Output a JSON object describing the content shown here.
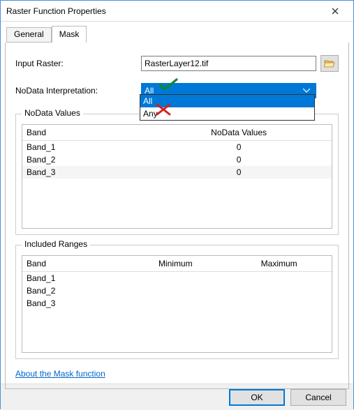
{
  "window": {
    "title": "Raster Function Properties"
  },
  "tabs": {
    "general": "General",
    "mask": "Mask"
  },
  "form": {
    "input_raster_label": "Input Raster:",
    "input_raster_value": "RasterLayer12.tif",
    "nodata_interp_label": "NoData Interpretation:",
    "nodata_interp_value": "All",
    "nodata_interp_options": {
      "o0": "All",
      "o1": "Any"
    }
  },
  "group_nodata": {
    "legend": "NoData Values",
    "col_band": "Band",
    "col_vals": "NoData Values",
    "r0_b": "Band_1",
    "r0_v": "0",
    "r1_b": "Band_2",
    "r1_v": "0",
    "r2_b": "Band_3",
    "r2_v": "0"
  },
  "group_ranges": {
    "legend": "Included Ranges",
    "col_band": "Band",
    "col_min": "Minimum",
    "col_max": "Maximum",
    "r0_b": "Band_1",
    "r1_b": "Band_2",
    "r2_b": "Band_3"
  },
  "link": {
    "about": "About the Mask function"
  },
  "buttons": {
    "ok": "OK",
    "cancel": "Cancel"
  }
}
